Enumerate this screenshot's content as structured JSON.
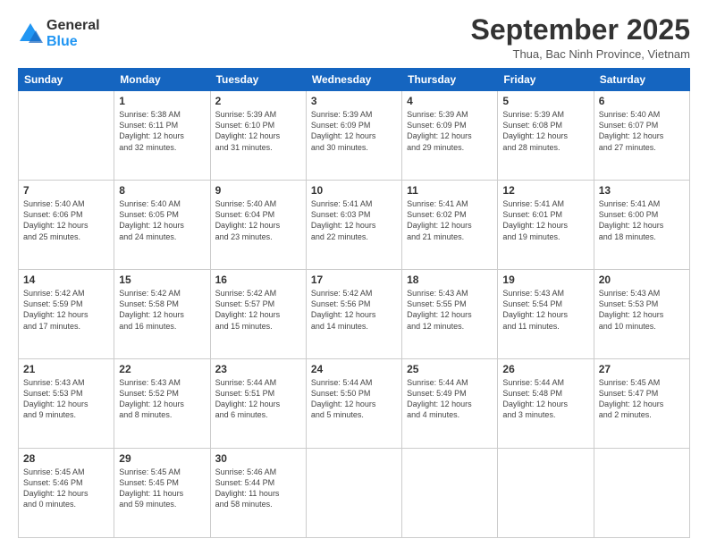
{
  "logo": {
    "general": "General",
    "blue": "Blue"
  },
  "header": {
    "month": "September 2025",
    "location": "Thua, Bac Ninh Province, Vietnam"
  },
  "days_of_week": [
    "Sunday",
    "Monday",
    "Tuesday",
    "Wednesday",
    "Thursday",
    "Friday",
    "Saturday"
  ],
  "weeks": [
    [
      {
        "day": "",
        "info": ""
      },
      {
        "day": "1",
        "info": "Sunrise: 5:38 AM\nSunset: 6:11 PM\nDaylight: 12 hours\nand 32 minutes."
      },
      {
        "day": "2",
        "info": "Sunrise: 5:39 AM\nSunset: 6:10 PM\nDaylight: 12 hours\nand 31 minutes."
      },
      {
        "day": "3",
        "info": "Sunrise: 5:39 AM\nSunset: 6:09 PM\nDaylight: 12 hours\nand 30 minutes."
      },
      {
        "day": "4",
        "info": "Sunrise: 5:39 AM\nSunset: 6:09 PM\nDaylight: 12 hours\nand 29 minutes."
      },
      {
        "day": "5",
        "info": "Sunrise: 5:39 AM\nSunset: 6:08 PM\nDaylight: 12 hours\nand 28 minutes."
      },
      {
        "day": "6",
        "info": "Sunrise: 5:40 AM\nSunset: 6:07 PM\nDaylight: 12 hours\nand 27 minutes."
      }
    ],
    [
      {
        "day": "7",
        "info": "Sunrise: 5:40 AM\nSunset: 6:06 PM\nDaylight: 12 hours\nand 25 minutes."
      },
      {
        "day": "8",
        "info": "Sunrise: 5:40 AM\nSunset: 6:05 PM\nDaylight: 12 hours\nand 24 minutes."
      },
      {
        "day": "9",
        "info": "Sunrise: 5:40 AM\nSunset: 6:04 PM\nDaylight: 12 hours\nand 23 minutes."
      },
      {
        "day": "10",
        "info": "Sunrise: 5:41 AM\nSunset: 6:03 PM\nDaylight: 12 hours\nand 22 minutes."
      },
      {
        "day": "11",
        "info": "Sunrise: 5:41 AM\nSunset: 6:02 PM\nDaylight: 12 hours\nand 21 minutes."
      },
      {
        "day": "12",
        "info": "Sunrise: 5:41 AM\nSunset: 6:01 PM\nDaylight: 12 hours\nand 19 minutes."
      },
      {
        "day": "13",
        "info": "Sunrise: 5:41 AM\nSunset: 6:00 PM\nDaylight: 12 hours\nand 18 minutes."
      }
    ],
    [
      {
        "day": "14",
        "info": "Sunrise: 5:42 AM\nSunset: 5:59 PM\nDaylight: 12 hours\nand 17 minutes."
      },
      {
        "day": "15",
        "info": "Sunrise: 5:42 AM\nSunset: 5:58 PM\nDaylight: 12 hours\nand 16 minutes."
      },
      {
        "day": "16",
        "info": "Sunrise: 5:42 AM\nSunset: 5:57 PM\nDaylight: 12 hours\nand 15 minutes."
      },
      {
        "day": "17",
        "info": "Sunrise: 5:42 AM\nSunset: 5:56 PM\nDaylight: 12 hours\nand 14 minutes."
      },
      {
        "day": "18",
        "info": "Sunrise: 5:43 AM\nSunset: 5:55 PM\nDaylight: 12 hours\nand 12 minutes."
      },
      {
        "day": "19",
        "info": "Sunrise: 5:43 AM\nSunset: 5:54 PM\nDaylight: 12 hours\nand 11 minutes."
      },
      {
        "day": "20",
        "info": "Sunrise: 5:43 AM\nSunset: 5:53 PM\nDaylight: 12 hours\nand 10 minutes."
      }
    ],
    [
      {
        "day": "21",
        "info": "Sunrise: 5:43 AM\nSunset: 5:53 PM\nDaylight: 12 hours\nand 9 minutes."
      },
      {
        "day": "22",
        "info": "Sunrise: 5:43 AM\nSunset: 5:52 PM\nDaylight: 12 hours\nand 8 minutes."
      },
      {
        "day": "23",
        "info": "Sunrise: 5:44 AM\nSunset: 5:51 PM\nDaylight: 12 hours\nand 6 minutes."
      },
      {
        "day": "24",
        "info": "Sunrise: 5:44 AM\nSunset: 5:50 PM\nDaylight: 12 hours\nand 5 minutes."
      },
      {
        "day": "25",
        "info": "Sunrise: 5:44 AM\nSunset: 5:49 PM\nDaylight: 12 hours\nand 4 minutes."
      },
      {
        "day": "26",
        "info": "Sunrise: 5:44 AM\nSunset: 5:48 PM\nDaylight: 12 hours\nand 3 minutes."
      },
      {
        "day": "27",
        "info": "Sunrise: 5:45 AM\nSunset: 5:47 PM\nDaylight: 12 hours\nand 2 minutes."
      }
    ],
    [
      {
        "day": "28",
        "info": "Sunrise: 5:45 AM\nSunset: 5:46 PM\nDaylight: 12 hours\nand 0 minutes."
      },
      {
        "day": "29",
        "info": "Sunrise: 5:45 AM\nSunset: 5:45 PM\nDaylight: 11 hours\nand 59 minutes."
      },
      {
        "day": "30",
        "info": "Sunrise: 5:46 AM\nSunset: 5:44 PM\nDaylight: 11 hours\nand 58 minutes."
      },
      {
        "day": "",
        "info": ""
      },
      {
        "day": "",
        "info": ""
      },
      {
        "day": "",
        "info": ""
      },
      {
        "day": "",
        "info": ""
      }
    ]
  ]
}
